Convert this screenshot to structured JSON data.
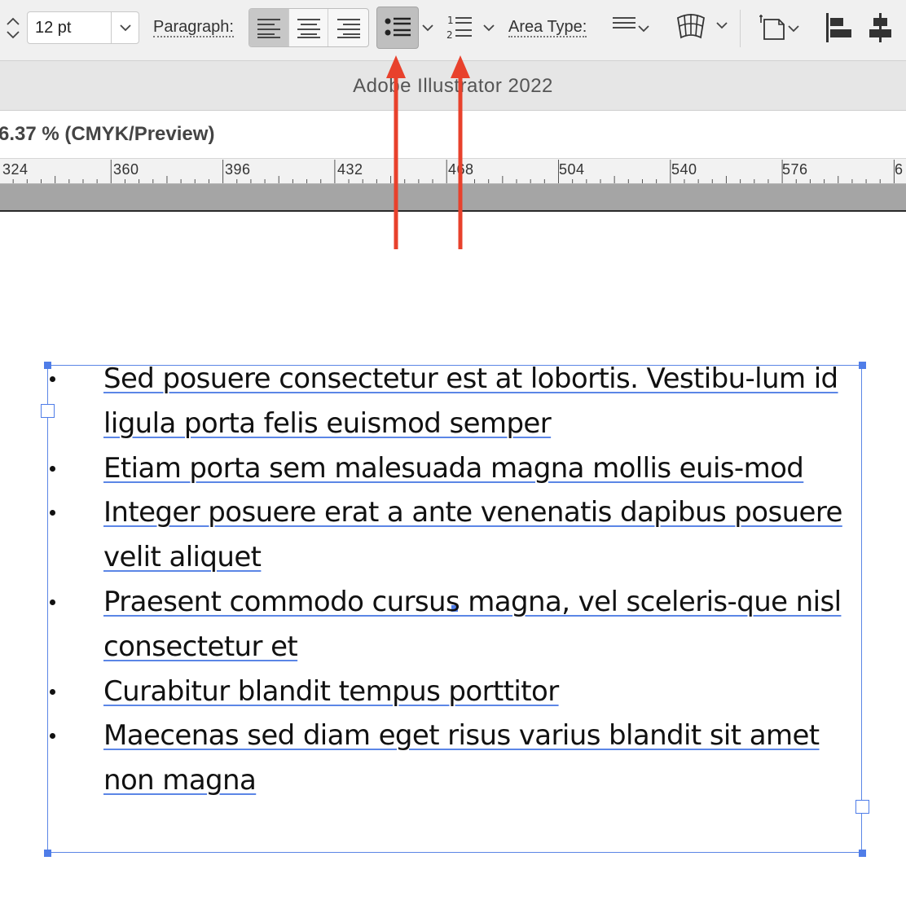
{
  "control_bar": {
    "font_size": "12 pt",
    "paragraph_label": "Paragraph:",
    "area_type_label": "Area Type:",
    "icons": {
      "stepper": "up-down-stepper-icon",
      "dropdown": "chevron-down-icon",
      "align_left": "align-left-icon",
      "align_center": "align-center-icon",
      "align_right": "align-right-icon",
      "bullets": "bulleted-list-icon",
      "numbers": "numbered-list-icon",
      "area_type": "area-type-icon",
      "warp": "envelope-warp-icon",
      "transform": "transform-options-icon",
      "align_left_objects": "align-left-objects-icon",
      "align_center_objects": "align-horizontal-center-icon"
    },
    "numbered_icon_digits": [
      "1",
      "2"
    ]
  },
  "title_bar": {
    "app_title": "Adobe Illustrator 2022"
  },
  "document": {
    "tab_title": "6.37 % (CMYK/Preview)"
  },
  "ruler": {
    "labels": [
      "324",
      "360",
      "396",
      "432",
      "468",
      "504",
      "540",
      "576",
      "6"
    ]
  },
  "annotation": {
    "arrow_color": "#e8412c",
    "arrow_count": 2
  },
  "selection_color": "#5b86e6",
  "text_frame": {
    "items": [
      "Sed posuere consectetur est at lobortis. Vestibu-lum id ligula porta felis euismod semper",
      "Etiam porta sem malesuada magna mollis euis-mod",
      "Integer posuere erat a ante venenatis dapibus posuere velit aliquet",
      "Praesent commodo cursus magna, vel sceleris-que nisl consectetur et",
      "Curabitur blandit tempus porttitor",
      "Maecenas sed diam eget risus varius blandit sit amet non magna"
    ]
  }
}
